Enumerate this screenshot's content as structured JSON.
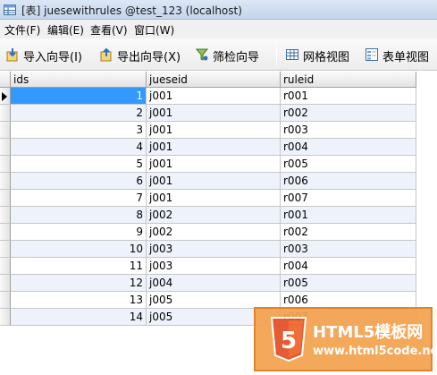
{
  "window": {
    "title": "[表] juesewithrules @test_123 (localhost)"
  },
  "menu": [
    {
      "label": "文件(F)"
    },
    {
      "label": "编辑(E)"
    },
    {
      "label": "查看(V)"
    },
    {
      "label": "窗口(W)"
    }
  ],
  "toolbar": {
    "import_label": "导入向导(I)",
    "export_label": "导出向导(X)",
    "filter_label": "筛检向导",
    "grid_view_label": "网格视图",
    "form_view_label": "表单视图"
  },
  "table": {
    "columns": [
      "ids",
      "jueseid",
      "ruleid"
    ],
    "selected_row": 1,
    "rows": [
      {
        "ids": "1",
        "jueseid": "j001",
        "ruleid": "r001"
      },
      {
        "ids": "2",
        "jueseid": "j001",
        "ruleid": "r002"
      },
      {
        "ids": "3",
        "jueseid": "j001",
        "ruleid": "r003"
      },
      {
        "ids": "4",
        "jueseid": "j001",
        "ruleid": "r004"
      },
      {
        "ids": "5",
        "jueseid": "j001",
        "ruleid": "r005"
      },
      {
        "ids": "6",
        "jueseid": "j001",
        "ruleid": "r006"
      },
      {
        "ids": "7",
        "jueseid": "j001",
        "ruleid": "r007"
      },
      {
        "ids": "8",
        "jueseid": "j002",
        "ruleid": "r001"
      },
      {
        "ids": "9",
        "jueseid": "j002",
        "ruleid": "r002"
      },
      {
        "ids": "10",
        "jueseid": "j003",
        "ruleid": "r003"
      },
      {
        "ids": "11",
        "jueseid": "j003",
        "ruleid": "r004"
      },
      {
        "ids": "12",
        "jueseid": "j004",
        "ruleid": "r005"
      },
      {
        "ids": "13",
        "jueseid": "j005",
        "ruleid": "r006"
      },
      {
        "ids": "14",
        "jueseid": "j005",
        "ruleid": "r007"
      }
    ]
  },
  "watermark": {
    "brand": "HTML5模板网",
    "url": "www.html5code.net"
  },
  "colors": {
    "selection": "#3399ff",
    "watermark": "#f4a24e"
  }
}
